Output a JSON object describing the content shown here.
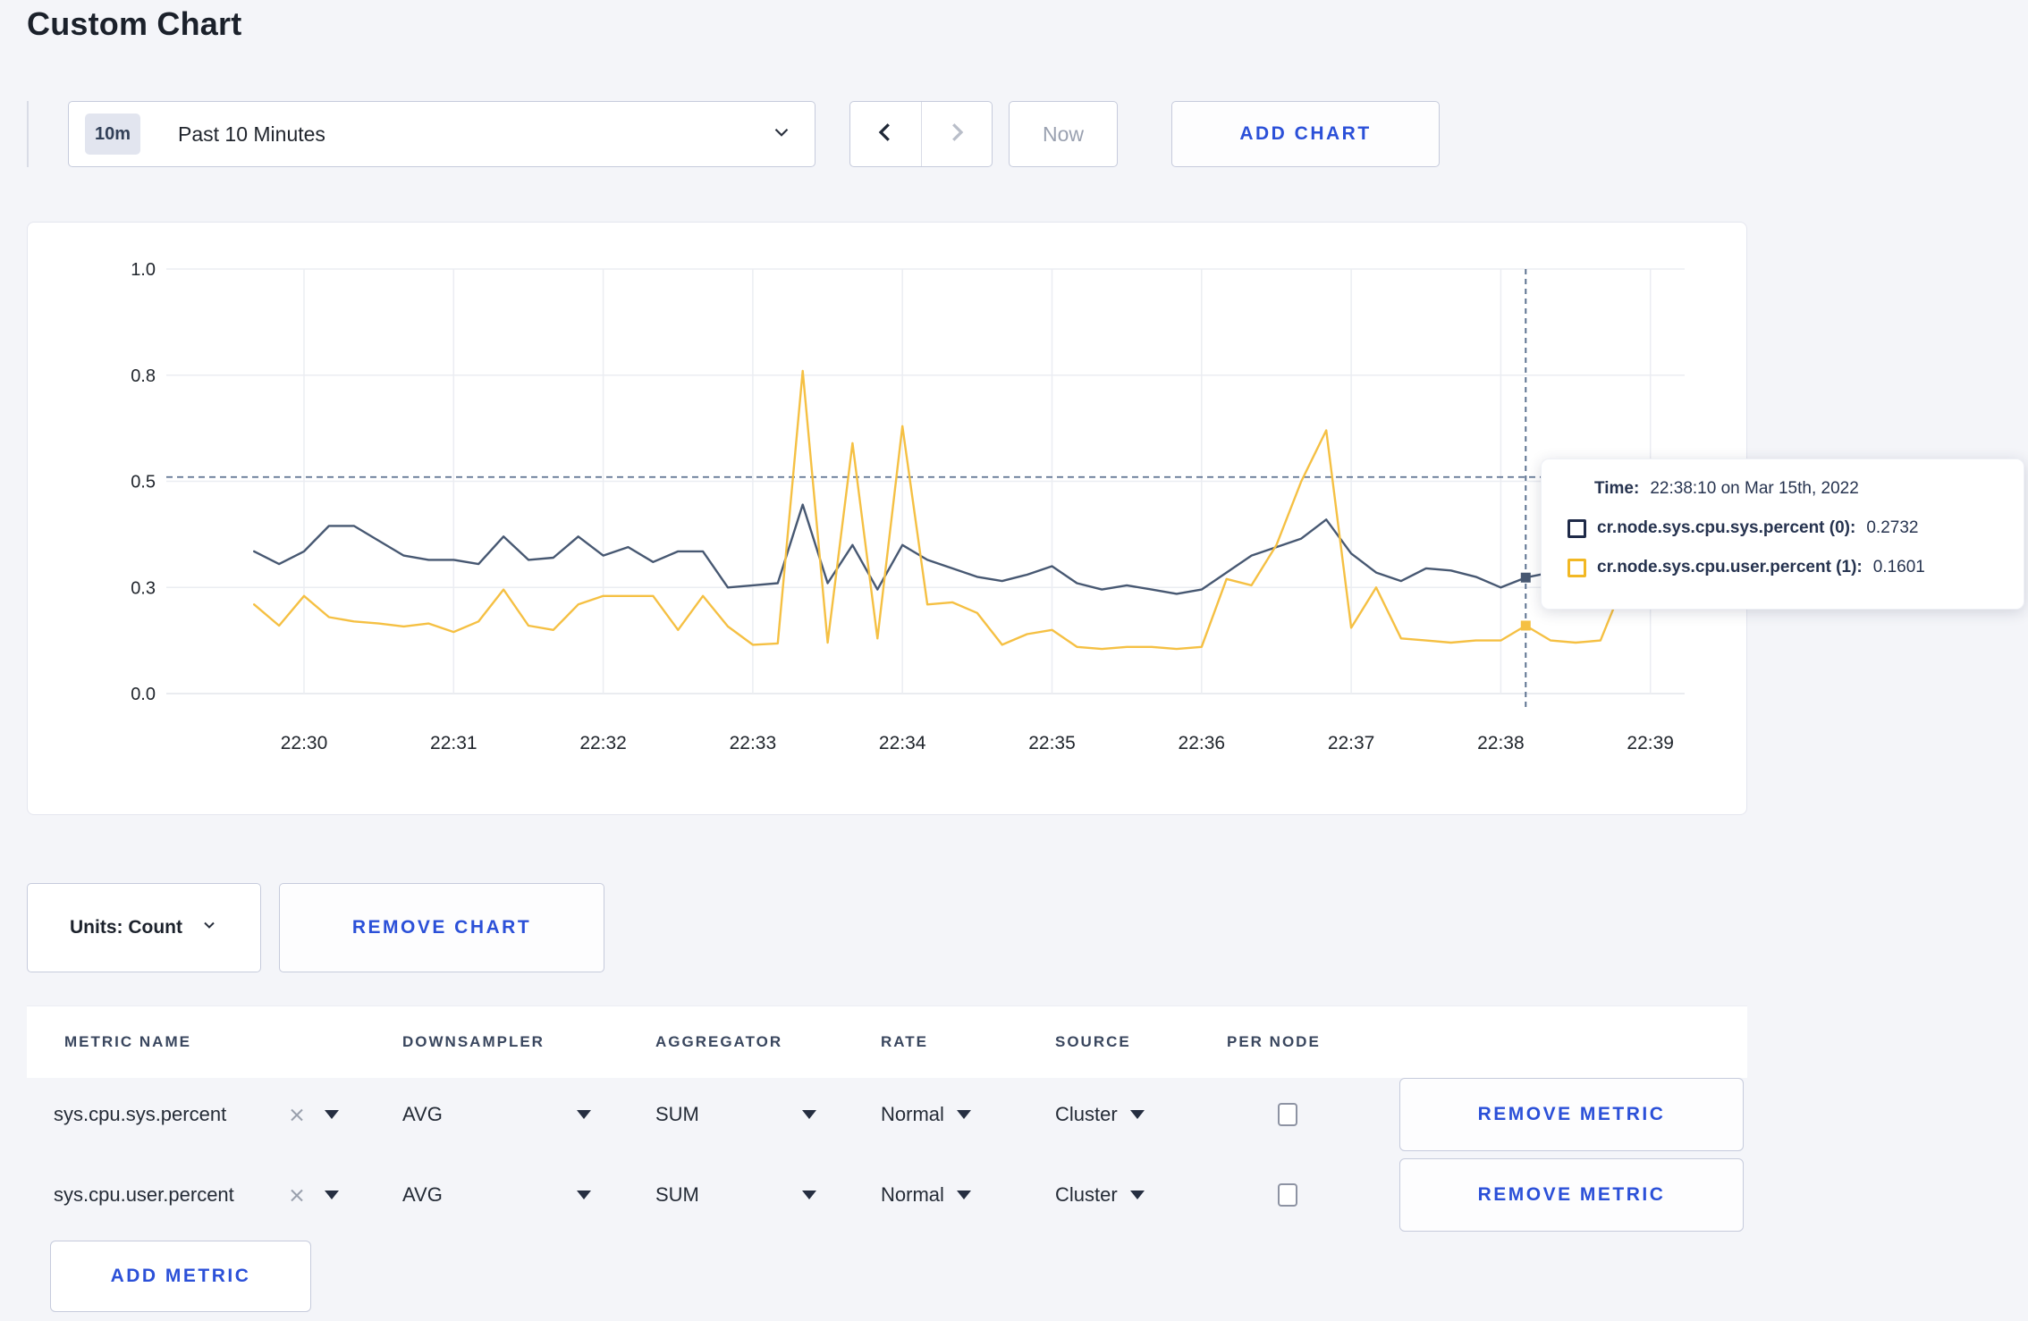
{
  "header": {
    "title": "Custom Chart"
  },
  "controls": {
    "time_window": {
      "badge": "10m",
      "label": "Past 10 Minutes"
    },
    "prev_enabled": true,
    "next_enabled": false,
    "now_label": "Now",
    "add_chart_label": "ADD CHART"
  },
  "chart_section": {
    "units_label": "Units: Count",
    "remove_chart_label": "REMOVE CHART"
  },
  "tooltip": {
    "time_label": "Time:",
    "time_value": "22:38:10 on Mar 15th, 2022",
    "rows": [
      {
        "name": "cr.node.sys.cpu.sys.percent (0):",
        "value": "0.2732",
        "swatch": "#1F2A48"
      },
      {
        "name": "cr.node.sys.cpu.user.percent (1):",
        "value": "0.1601",
        "swatch": "#F2B824"
      }
    ]
  },
  "chart_data": {
    "type": "line",
    "title": "",
    "xlabel": "",
    "ylabel": "",
    "ylim": [
      0,
      1
    ],
    "grid": true,
    "x_ticks": [
      "22:30",
      "22:31",
      "22:32",
      "22:33",
      "22:34",
      "22:35",
      "22:36",
      "22:37",
      "22:38",
      "22:39"
    ],
    "y_ticks": [
      {
        "label": "1.0",
        "value": 1.0
      },
      {
        "label": "0.8",
        "value": 0.75
      },
      {
        "label": "0.5",
        "value": 0.5
      },
      {
        "label": "0.3",
        "value": 0.25
      },
      {
        "label": "0.0",
        "value": 0.0
      }
    ],
    "points_start_time": "22:29:40",
    "points_start_offset_sec": -20,
    "step_sec": 10,
    "series": [
      {
        "name": "cr.node.sys.cpu.sys.percent",
        "color": "#475872",
        "values": [
          0.335,
          0.305,
          0.335,
          0.395,
          0.395,
          0.36,
          0.325,
          0.315,
          0.315,
          0.305,
          0.37,
          0.315,
          0.32,
          0.37,
          0.325,
          0.345,
          0.31,
          0.335,
          0.335,
          0.25,
          0.255,
          0.26,
          0.445,
          0.26,
          0.35,
          0.245,
          0.35,
          0.315,
          0.295,
          0.275,
          0.265,
          0.28,
          0.3,
          0.26,
          0.245,
          0.255,
          0.245,
          0.235,
          0.245,
          0.285,
          0.325,
          0.345,
          0.365,
          0.41,
          0.33,
          0.285,
          0.265,
          0.295,
          0.29,
          0.275,
          0.25,
          0.2732,
          0.285,
          0.27,
          0.26,
          0.29,
          0.295,
          0.295
        ]
      },
      {
        "name": "cr.node.sys.cpu.user.percent",
        "color": "#F5C043",
        "values": [
          0.21,
          0.16,
          0.23,
          0.18,
          0.17,
          0.165,
          0.158,
          0.165,
          0.145,
          0.17,
          0.245,
          0.16,
          0.15,
          0.21,
          0.23,
          0.23,
          0.23,
          0.15,
          0.23,
          0.158,
          0.115,
          0.118,
          0.76,
          0.12,
          0.59,
          0.13,
          0.63,
          0.21,
          0.215,
          0.19,
          0.115,
          0.14,
          0.15,
          0.11,
          0.105,
          0.11,
          0.11,
          0.105,
          0.11,
          0.27,
          0.255,
          0.35,
          0.5,
          0.62,
          0.155,
          0.25,
          0.13,
          0.125,
          0.12,
          0.125,
          0.125,
          0.1601,
          0.125,
          0.12,
          0.125,
          0.27,
          0.26,
          0.21
        ]
      }
    ],
    "crosshair": {
      "time": "22:38:10",
      "point_index": 51,
      "hline_value": 0.51
    },
    "legend_position": "tooltip"
  },
  "metrics": {
    "columns": [
      "METRIC NAME",
      "DOWNSAMPLER",
      "AGGREGATOR",
      "RATE",
      "SOURCE",
      "PER NODE"
    ],
    "rows": [
      {
        "name": "sys.cpu.sys.percent",
        "downsampler": "AVG",
        "aggregator": "SUM",
        "rate": "Normal",
        "source": "Cluster",
        "per_node": false,
        "remove_label": "REMOVE METRIC"
      },
      {
        "name": "sys.cpu.user.percent",
        "downsampler": "AVG",
        "aggregator": "SUM",
        "rate": "Normal",
        "source": "Cluster",
        "per_node": false,
        "remove_label": "REMOVE METRIC"
      }
    ],
    "add_metric_label": "ADD METRIC"
  },
  "colors": {
    "accent_blue": "#2B50D8",
    "page_background": "#F4F5F9",
    "gridline": "#EBEDF2",
    "crosshair": "#5D7290"
  }
}
